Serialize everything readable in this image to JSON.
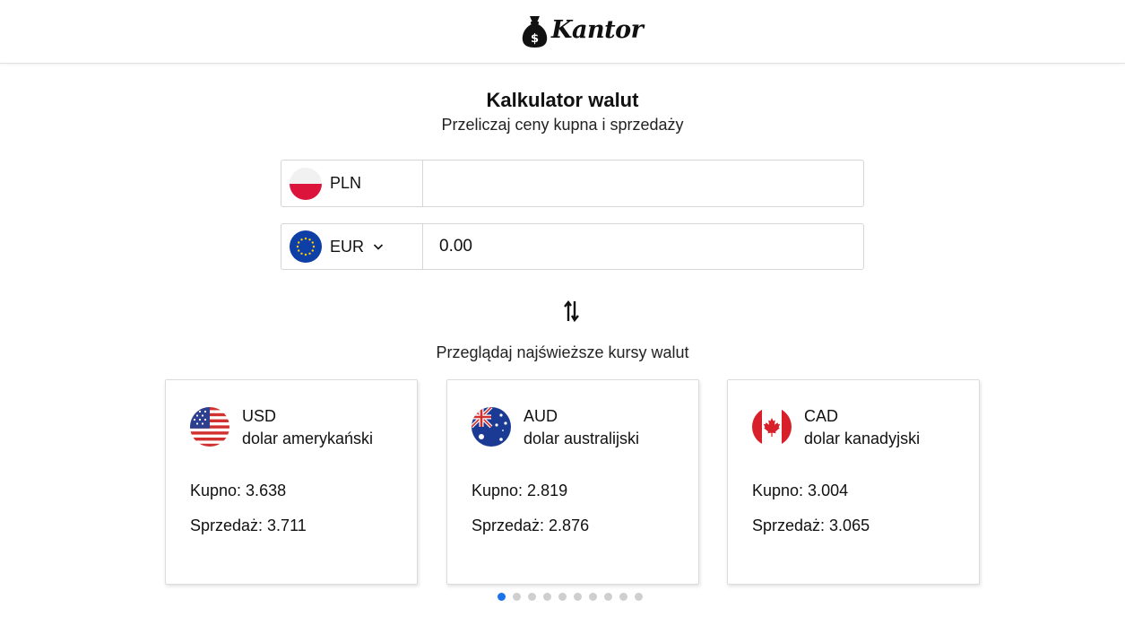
{
  "header": {
    "logo_text": "Kantor",
    "logo_icon": "money-bag-icon"
  },
  "calculator": {
    "title": "Kalkulator walut",
    "subtitle": "Przeliczaj ceny kupna i sprzedaży",
    "from": {
      "currency": "PLN",
      "value": "",
      "flag": "poland-flag-icon"
    },
    "to": {
      "currency": "EUR",
      "value": "0.00",
      "flag": "eu-flag-icon"
    },
    "swap_icon": "swap-arrows-icon"
  },
  "rates": {
    "heading": "Przeglądaj najświeższe kursy walut",
    "cards": [
      {
        "code": "USD",
        "name": "dolar amerykański",
        "buy": "Kupno: 3.638",
        "sell": "Sprzedaż: 3.711",
        "flag": "usa-flag-icon"
      },
      {
        "code": "AUD",
        "name": "dolar australijski",
        "buy": "Kupno: 2.819",
        "sell": "Sprzedaż: 2.876",
        "flag": "australia-flag-icon"
      },
      {
        "code": "CAD",
        "name": "dolar kanadyjski",
        "buy": "Kupno: 3.004",
        "sell": "Sprzedaż: 3.065",
        "flag": "canada-flag-icon"
      }
    ],
    "pagination": {
      "pages": 10,
      "active_page": 1
    }
  },
  "colors": {
    "accent": "#1a73e8",
    "border": "#d6d6d6"
  }
}
